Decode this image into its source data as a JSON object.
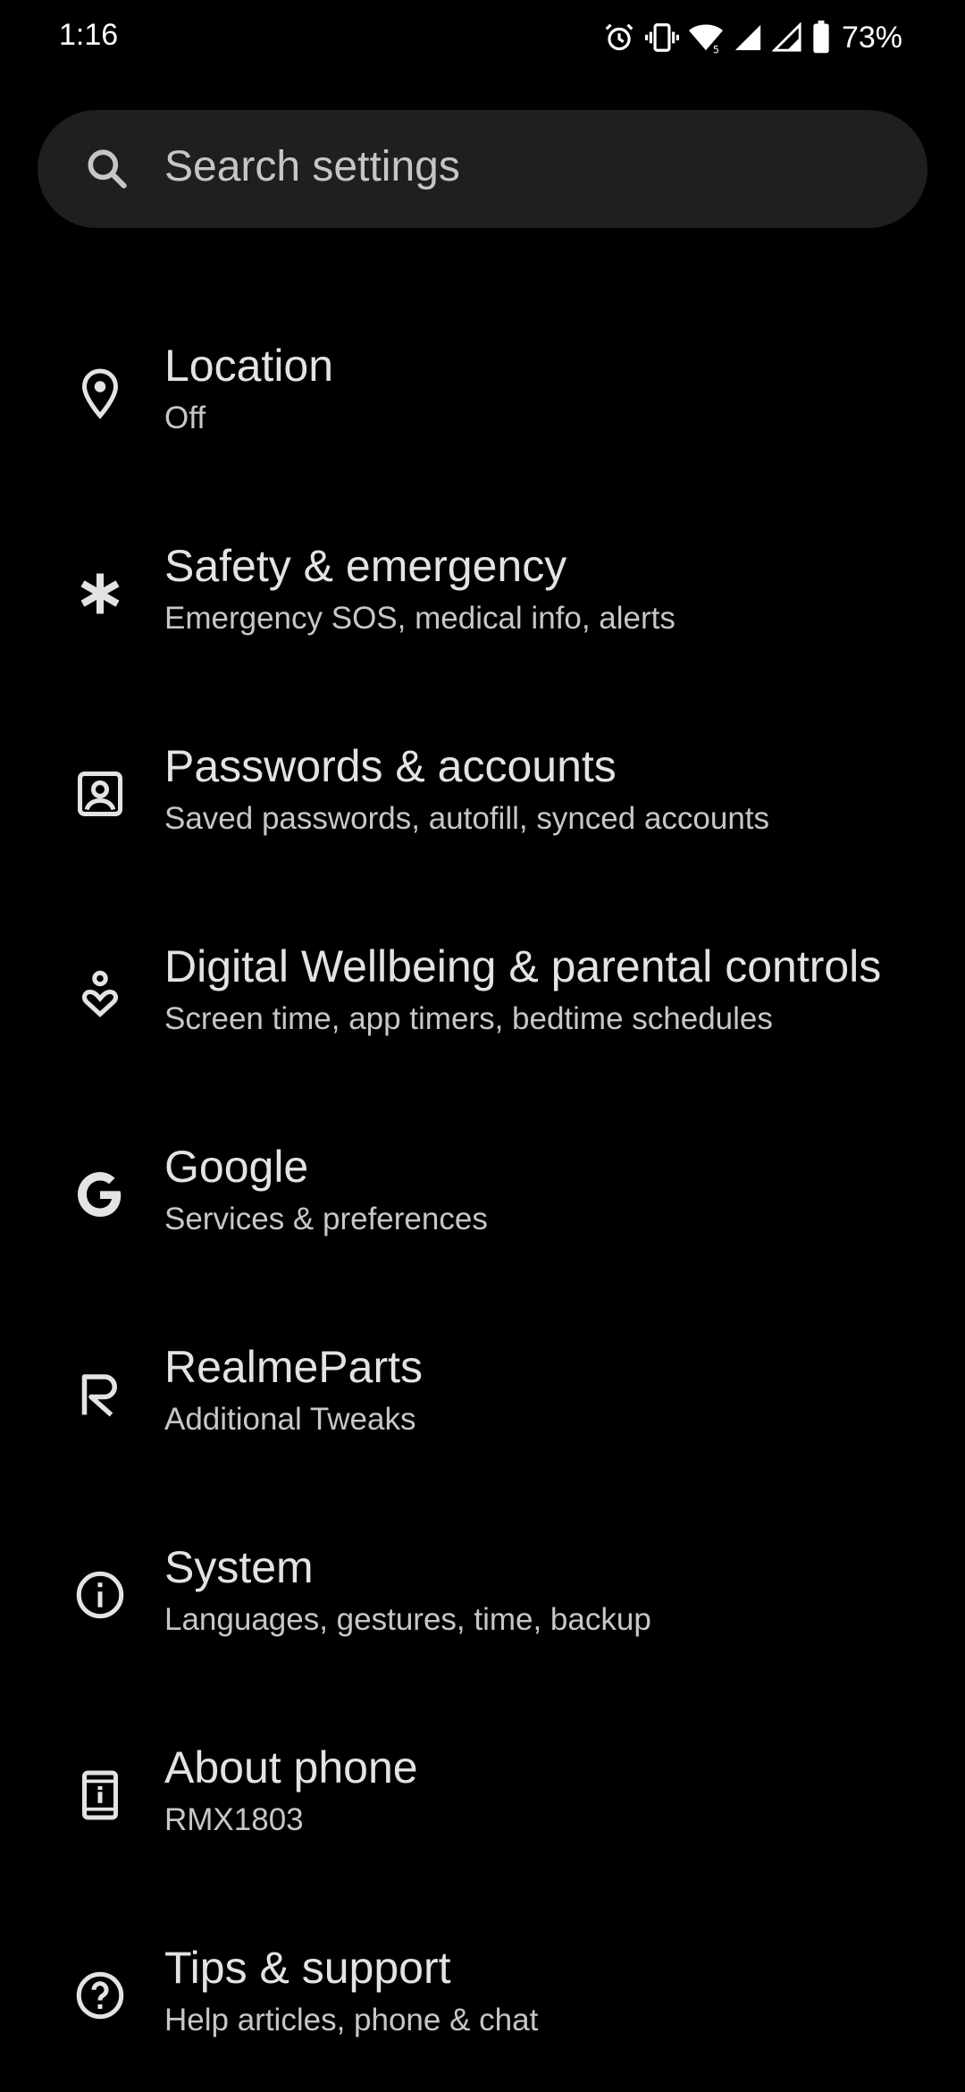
{
  "status_bar": {
    "time": "1:16",
    "battery_percent": "73%",
    "icons": [
      "alarm-icon",
      "vibrate-icon",
      "wifi-icon",
      "signal-icon",
      "signal-icon",
      "battery-icon"
    ]
  },
  "search": {
    "placeholder": "Search settings"
  },
  "settings": [
    {
      "icon": "location-pin-icon",
      "title": "Location",
      "subtitle": "Off"
    },
    {
      "icon": "asterisk-icon",
      "title": "Safety & emergency",
      "subtitle": "Emergency SOS, medical info, alerts"
    },
    {
      "icon": "account-box-icon",
      "title": "Passwords & accounts",
      "subtitle": "Saved passwords, autofill, synced accounts"
    },
    {
      "icon": "wellbeing-icon",
      "title": "Digital Wellbeing & parental controls",
      "subtitle": "Screen time, app timers, bedtime schedules"
    },
    {
      "icon": "google-icon",
      "title": "Google",
      "subtitle": "Services & preferences"
    },
    {
      "icon": "realme-icon",
      "title": "RealmeParts",
      "subtitle": "Additional Tweaks"
    },
    {
      "icon": "info-icon",
      "title": "System",
      "subtitle": "Languages, gestures, time, backup"
    },
    {
      "icon": "phone-info-icon",
      "title": "About phone",
      "subtitle": "RMX1803"
    },
    {
      "icon": "help-icon",
      "title": "Tips & support",
      "subtitle": "Help articles, phone & chat"
    }
  ],
  "colors": {
    "background": "#000000",
    "search_bg": "#1f1f1f",
    "title_text": "#e3e3e3",
    "subtitle_text": "#c7c7c7"
  }
}
